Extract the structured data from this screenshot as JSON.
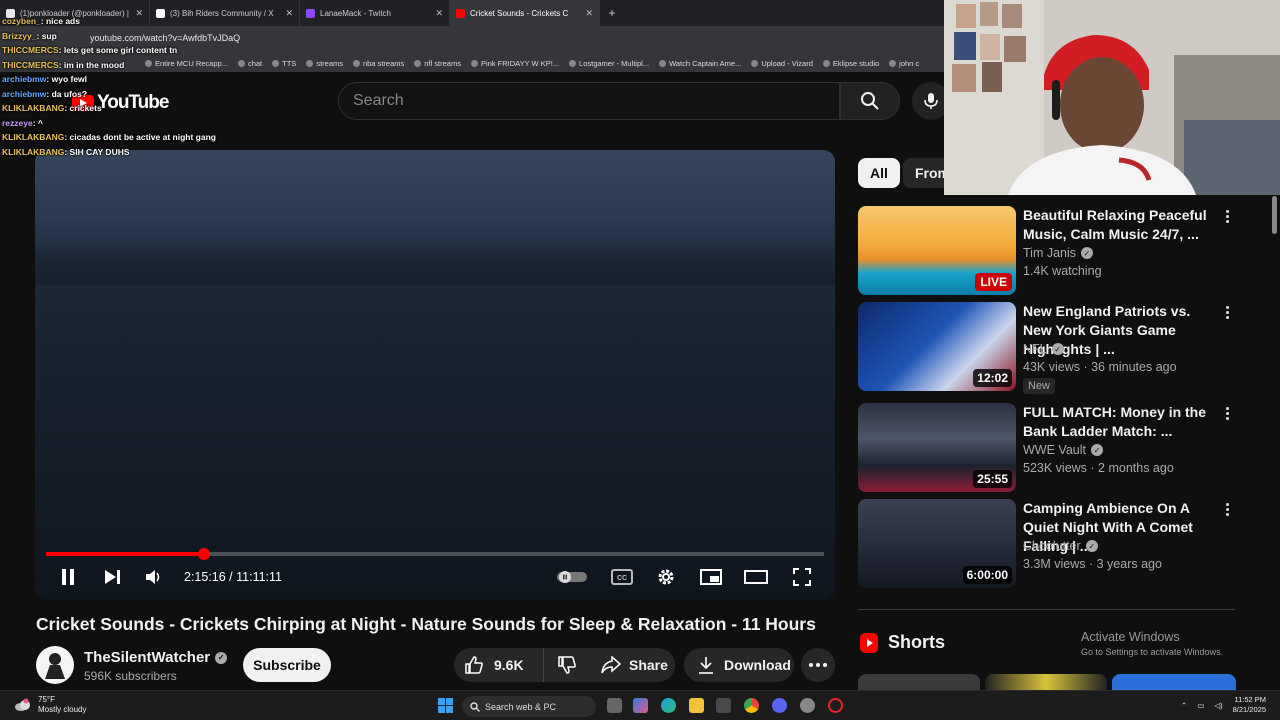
{
  "browser": {
    "tabs": [
      {
        "title": "(1)ponkloader (@ponkloader) |",
        "color": "#e8e8e8"
      },
      {
        "title": "(3) Bih Riders Community / X",
        "color": "#ffffff"
      },
      {
        "title": "LanaeMack - Twitch",
        "color": "#9146ff"
      },
      {
        "title": "Cricket Sounds - Crickets C",
        "color": "#ff0000",
        "active": true
      }
    ],
    "url": "youtube.com/watch?v=AwfdbTvJDaQ",
    "bookmarks": [
      "Entire MCU Recapp...",
      "chat",
      "TTS",
      "streams",
      "nba streams",
      "nfl streams",
      "Pink FRIDAYY W KP!...",
      "Lostgamer - Multipl...",
      "Watch Captain Ame...",
      "Upload - Vizard",
      "Eklipse studio",
      "john c"
    ]
  },
  "chat": [
    {
      "user": "cozyben_",
      "msg": "nice ads",
      "c": "u"
    },
    {
      "user": "Brizzyy_",
      "msg": "sup",
      "c": "u"
    },
    {
      "user": "THICCMERCS",
      "msg": "lets get some girl content tn",
      "c": "u"
    },
    {
      "user": "THICCMERCS",
      "msg": "im in the mood",
      "c": "u"
    },
    {
      "user": "archiebmw",
      "msg": "wyo fewl",
      "c": "b"
    },
    {
      "user": "archiebmw",
      "msg": "da ufos?",
      "c": "b"
    },
    {
      "user": "KLIKLAKBANG",
      "msg": "crickets",
      "c": "u"
    },
    {
      "user": "rezzeye",
      "msg": "^",
      "c": "p"
    },
    {
      "user": "KLIKLAKBANG",
      "msg": "cicadas dont be active at night gang",
      "c": "u"
    },
    {
      "user": "KLIKLAKBANG",
      "msg": "SIH CAY DUHS",
      "c": "u"
    }
  ],
  "youtube": {
    "logo_text": "YouTube",
    "search_placeholder": "Search"
  },
  "player": {
    "current_time": "2:15:16",
    "duration": "11:11:11",
    "time_display": "2:15:16 / 11:11:11",
    "progress_fraction": 0.2025
  },
  "video": {
    "title": "Cricket Sounds - Crickets Chirping at Night - Nature Sounds for Sleep & Relaxation - 11 Hours",
    "channel": "TheSilentWatcher",
    "subscribers": "596K subscribers",
    "subscribe_label": "Subscribe",
    "likes": "9.6K",
    "share_label": "Share",
    "download_label": "Download"
  },
  "sidebar": {
    "chips": [
      "All",
      "From"
    ],
    "recommendations": [
      {
        "title": "Beautiful Relaxing Peaceful Music, Calm Music 24/7, ...",
        "channel": "Tim Janis",
        "meta": "1.4K watching",
        "badge": "LIVE",
        "thumb": "linear-gradient(180deg,#f7c96a 0%,#f4a93c 45%,#e98f2a 60%,#1aa3c9 75%,#0b7fa8 100%)"
      },
      {
        "title": "New England Patriots vs. New York Giants Game Highlights | ...",
        "channel": "NFL",
        "meta": "43K views · 36 minutes ago",
        "duration": "12:02",
        "tag": "New",
        "thumb": "linear-gradient(135deg,#0b2a6b 0%,#2154b8 45%,#c9d6ec 70%,#8b0f1e 100%)"
      },
      {
        "title": "FULL MATCH: Money in the Bank Ladder Match: ...",
        "channel": "WWE Vault",
        "meta": "523K views · 2 months ago",
        "duration": "25:55",
        "thumb": "linear-gradient(180deg,#2b3140 0%,#4d5669 40%,#1c2230 70%,#8a1c36 100%)"
      },
      {
        "title": "Camping Ambience On A Quiet Night With A Comet Falling | ...",
        "channel": "Choolutter",
        "meta": "3.3M views · 3 years ago",
        "duration": "6:00:00",
        "thumb": "linear-gradient(180deg,#3a3f52 0%,#2a2f40 45%,#151922 100%)"
      }
    ],
    "shorts_label": "Shorts"
  },
  "windows": {
    "activate_title": "Activate Windows",
    "activate_sub": "Go to Settings to activate Windows."
  },
  "taskbar": {
    "temp": "75°F",
    "weather": "Mostly cloudy",
    "search_label": "Search web & PC",
    "time": "11:52 PM",
    "date": "8/21/2025"
  }
}
